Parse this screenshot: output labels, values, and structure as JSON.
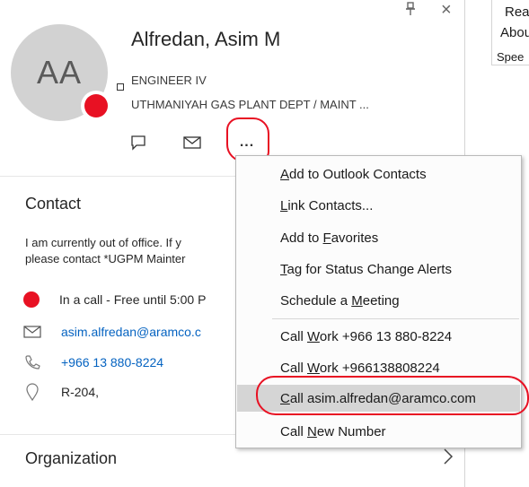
{
  "window": {
    "pin_glyph": "🖈",
    "close_glyph": "×"
  },
  "profile": {
    "initials": "AA",
    "name": "Alfredan, Asim M",
    "title": "ENGINEER IV",
    "department": "UTHMANIYAH GAS PLANT DEPT / MAINT ...",
    "presence_color": "#e81123"
  },
  "actions": {
    "chat_icon": "chat-bubble-icon",
    "mail_icon": "envelope-icon",
    "more_label": "...",
    "highlight_color": "#e81123"
  },
  "contact": {
    "heading": "Contact",
    "out_of_office": "I am currently out of office. If y\nplease contact *UGPM Mainter",
    "presence_text": "In a call - Free until 5:00 P",
    "email": "asim.alfredan@aramco.c",
    "phone": "+966 13 880-8224",
    "location": "R-204,"
  },
  "organization": {
    "heading": "Organization",
    "chevron": ">"
  },
  "right_pane": {
    "line1": "Rea",
    "line2": "Abou",
    "line3": "Spee"
  },
  "menu": {
    "items": [
      {
        "label": "Add to Outlook Contacts",
        "underline": "A",
        "highlighted": false
      },
      {
        "label": "Link Contacts...",
        "underline": "L",
        "highlighted": false
      },
      {
        "label": "Add to Favorites",
        "underline": "F",
        "highlighted": false
      },
      {
        "label": "Tag for Status Change Alerts",
        "underline": "T",
        "highlighted": false
      },
      {
        "label": "Schedule a Meeting",
        "underline": "M",
        "highlighted": false
      },
      {
        "label": "Call Work +966 13 880-8224",
        "underline": "W",
        "highlighted": false
      },
      {
        "label": "Call Work +966138808224",
        "underline": "W",
        "highlighted": false
      },
      {
        "label": "Call asim.alfredan@aramco.com",
        "underline": "C",
        "highlighted": true
      },
      {
        "label": "Call New Number",
        "underline": "N",
        "highlighted": false
      }
    ]
  }
}
